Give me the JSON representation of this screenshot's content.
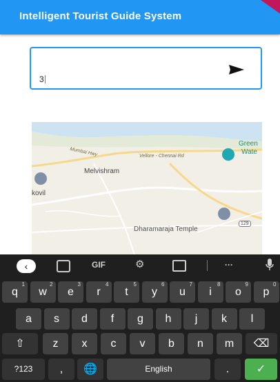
{
  "app_bar": {
    "title": "Intelligent Tourist Guide System"
  },
  "search": {
    "value": "3"
  },
  "map": {
    "labels": {
      "mumbai_hwy": "Mumbai Hwy",
      "vellore_rd": "Vellore - Chennai Rd",
      "melvishram": "Melvishram",
      "kovil": "kovil",
      "green_water_1": "Green",
      "green_water_2": "Wate",
      "temple": "Dharamaraja Temple",
      "route_shield": "129"
    }
  },
  "keyboard": {
    "suggestions": {
      "gif": "GIF",
      "more": "···"
    },
    "rows": {
      "row1": [
        {
          "k": "q",
          "s": "1"
        },
        {
          "k": "w",
          "s": "2"
        },
        {
          "k": "e",
          "s": "3"
        },
        {
          "k": "r",
          "s": "4"
        },
        {
          "k": "t",
          "s": "5"
        },
        {
          "k": "y",
          "s": "6"
        },
        {
          "k": "u",
          "s": "7"
        },
        {
          "k": "i",
          "s": "8"
        },
        {
          "k": "o",
          "s": "9"
        },
        {
          "k": "p",
          "s": "0"
        }
      ],
      "row2": [
        "a",
        "s",
        "d",
        "f",
        "g",
        "h",
        "j",
        "k",
        "l"
      ],
      "row3": [
        "z",
        "x",
        "c",
        "v",
        "b",
        "n",
        "m"
      ]
    },
    "sym_label": "?123",
    "comma": ",",
    "space_label": "English",
    "period": "."
  },
  "colors": {
    "accent": "#2196f3",
    "enter": "#4caf50",
    "keyboard_bg": "#1f1f1f"
  }
}
